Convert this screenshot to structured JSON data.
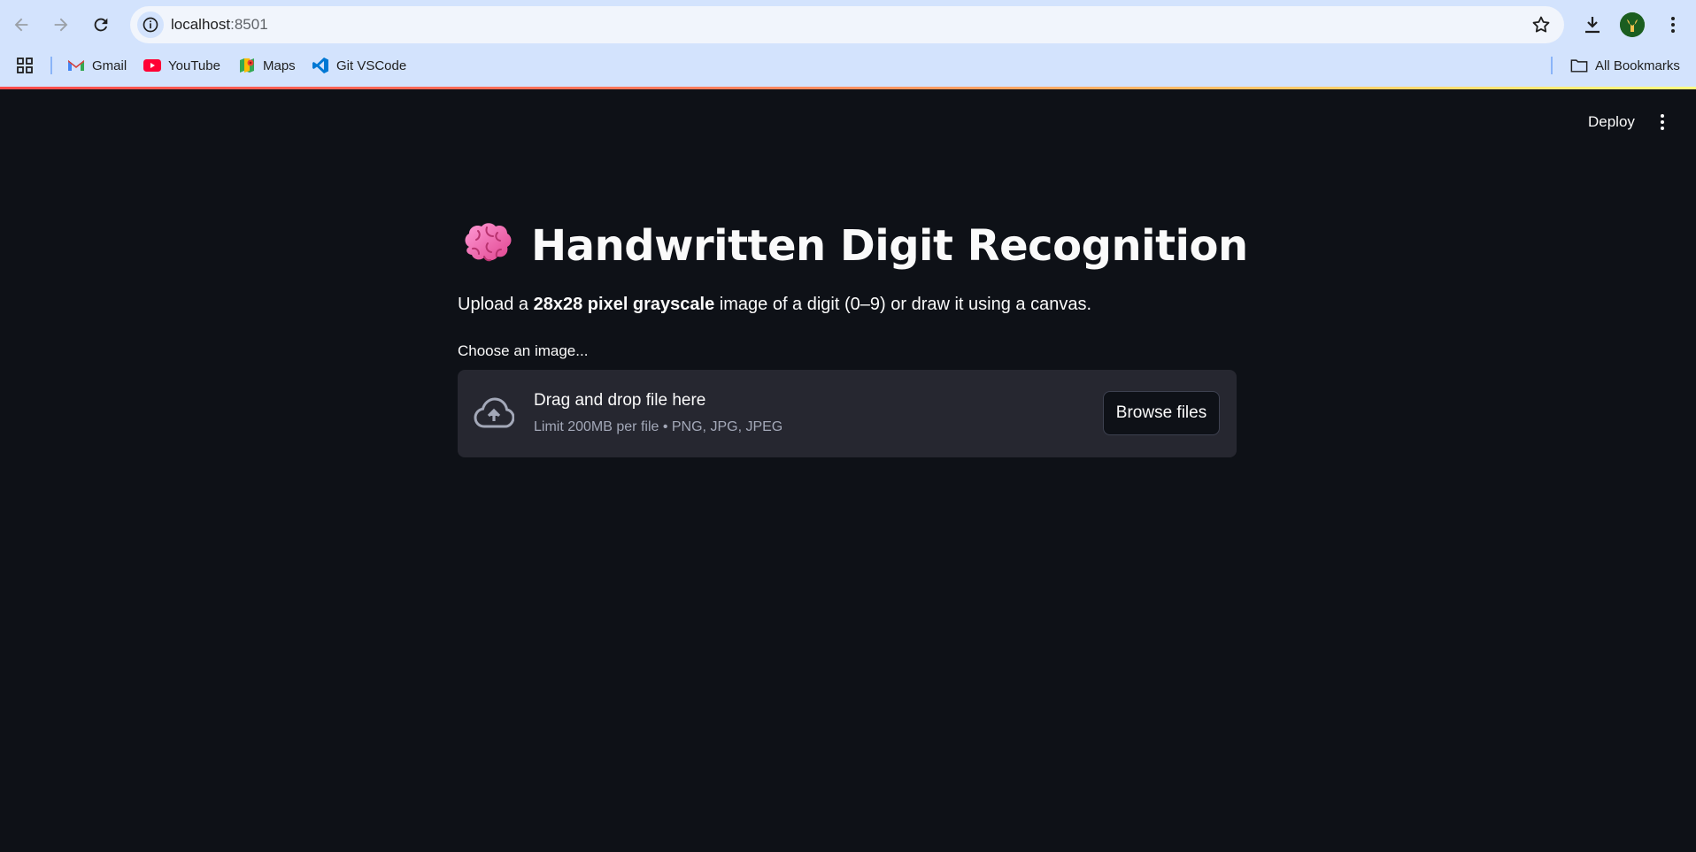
{
  "browser": {
    "url_host": "localhost",
    "url_port": ":8501",
    "bookmarks": [
      {
        "label": "Gmail",
        "icon": "gmail-icon"
      },
      {
        "label": "YouTube",
        "icon": "youtube-icon"
      },
      {
        "label": "Maps",
        "icon": "maps-icon"
      },
      {
        "label": "Git VSCode",
        "icon": "vscode-icon"
      }
    ],
    "all_bookmarks_label": "All Bookmarks"
  },
  "app_header": {
    "deploy_label": "Deploy"
  },
  "main": {
    "title_emoji": "brain-icon",
    "title": "Handwritten Digit Recognition",
    "subtitle_prefix": "Upload a ",
    "subtitle_bold": "28x28 pixel grayscale",
    "subtitle_suffix": " image of a digit (0–9) or draw it using a canvas.",
    "uploader": {
      "label": "Choose an image...",
      "drag_text": "Drag and drop file here",
      "limit_text": "Limit 200MB per file • PNG, JPG, JPEG",
      "browse_label": "Browse files"
    }
  },
  "colors": {
    "app_background": "#0e1117",
    "dropzone_background": "#262730",
    "chrome_background": "#d3e3fd",
    "text_primary": "#fafafa",
    "text_muted": "#a3a8b8"
  }
}
